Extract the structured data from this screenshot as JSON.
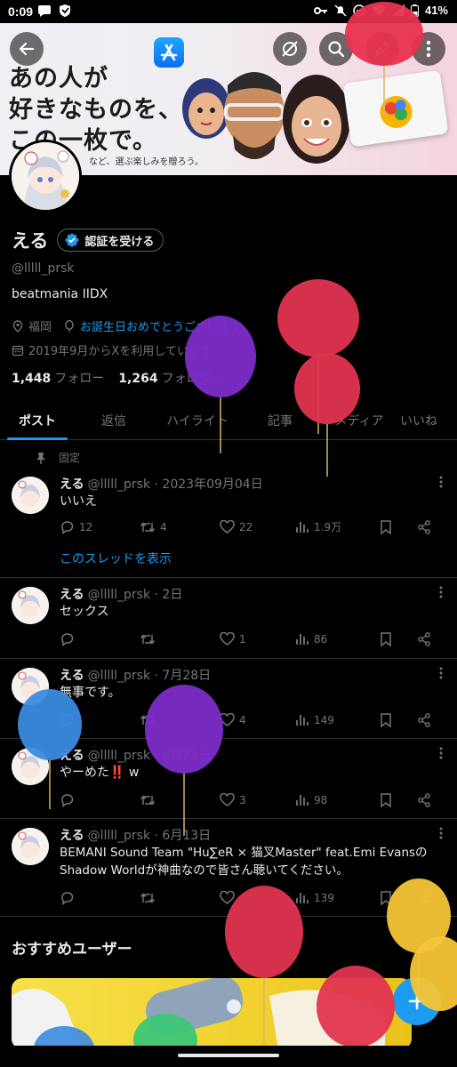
{
  "status_bar": {
    "time": "0:09",
    "battery": "41%"
  },
  "banner": {
    "line1": "あの人が",
    "line2": "好きなものを、",
    "line3": "この一枚で。",
    "small": "など、選ぶ楽しみを贈ろう。"
  },
  "profile": {
    "name": "える",
    "verify_label": "認証を受ける",
    "handle": "@lllll_prsk",
    "bio": "beatmania IIDX",
    "location": "福岡",
    "birthday_link": "お誕生日おめでとうございます。",
    "joined": "2019年9月からXを利用しています",
    "following_count": "1,448",
    "following_label": "フォロー",
    "followers_count": "1,264",
    "followers_label": "フォロワー"
  },
  "tabs": [
    {
      "label": "ポスト"
    },
    {
      "label": "返信"
    },
    {
      "label": "ハイライト"
    },
    {
      "label": "記事"
    },
    {
      "label": "メディア"
    },
    {
      "label": "いいね"
    }
  ],
  "pinned_label": "固定",
  "posts": [
    {
      "name": "える",
      "meta": "@lllll_prsk · 2023年09月04日",
      "text": "いいえ",
      "replies": "12",
      "reposts": "4",
      "likes": "22",
      "views": "1.9万",
      "thread_link": "このスレッドを表示"
    },
    {
      "name": "える",
      "meta": "@lllll_prsk · 2日",
      "text": "セックス",
      "replies": "",
      "reposts": "",
      "likes": "1",
      "views": "86"
    },
    {
      "name": "える",
      "meta": "@lllll_prsk · 7月28日",
      "text": "無事です。",
      "replies": "",
      "reposts": "",
      "likes": "4",
      "views": "149"
    },
    {
      "name": "える",
      "meta": "@lllll_prsk · 6月21日",
      "text": "やーめた‼️ w",
      "replies": "",
      "reposts": "",
      "likes": "3",
      "views": "98"
    },
    {
      "name": "える",
      "meta": "@lllll_prsk · 6月13日",
      "text": "BEMANI Sound Team \"Hu∑eR × 猫叉Master\" feat.Emi EvansのShadow Worldが神曲なので皆さん聴いてください。",
      "replies": "",
      "reposts": "",
      "likes": "",
      "views": "139"
    }
  ],
  "recommended_title": "おすすめユーザー",
  "colors": {
    "accent": "#1d9bf0",
    "muted": "#71767b",
    "text": "#e7e9ea",
    "divider": "#2f3336"
  }
}
